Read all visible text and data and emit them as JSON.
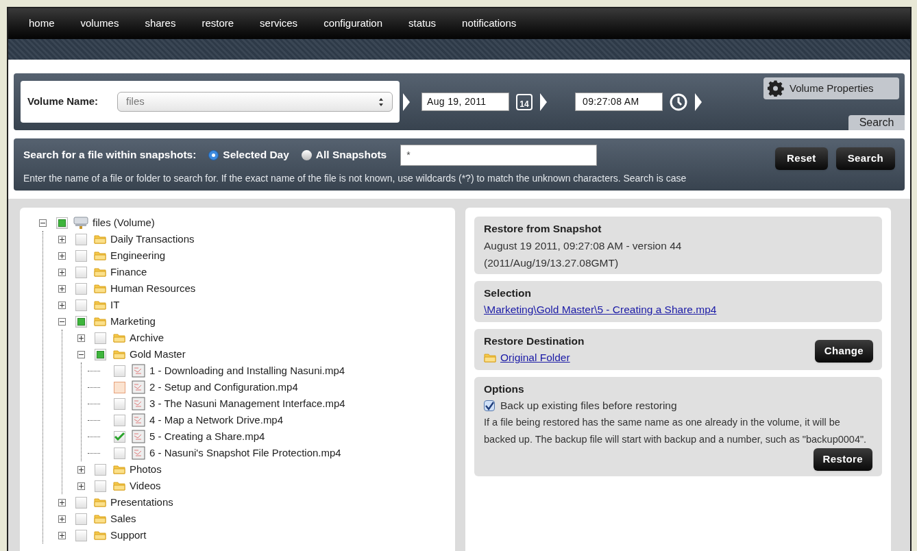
{
  "nav": [
    "home",
    "volumes",
    "shares",
    "restore",
    "services",
    "configuration",
    "status",
    "notifications"
  ],
  "snapshot_bar": {
    "volume_label": "Volume Name:",
    "volume_value": "files",
    "date": "Aug 19, 2011",
    "calendar_day": "14",
    "time": "09:27:08 AM",
    "properties_button": "Volume Properties",
    "tab": "Search"
  },
  "search": {
    "label": "Search for a file within snapshots:",
    "options": [
      {
        "label": "Selected Day",
        "selected": true
      },
      {
        "label": "All Snapshots",
        "selected": false
      }
    ],
    "value": "*",
    "buttons": [
      "Reset",
      "Search"
    ],
    "help": "Enter the name of a file or folder to search for. If the exact name of the file is not known, use wildcards (*?) to match the unknown characters. Search is case"
  },
  "tree": [
    {
      "label": "files (Volume)",
      "kind": "volume",
      "checked": false,
      "partial": true,
      "expanded": true,
      "children": [
        {
          "label": "Daily Transactions",
          "kind": "folder",
          "checked": false,
          "partial": false,
          "expanded": false
        },
        {
          "label": "Engineering",
          "kind": "folder",
          "checked": false,
          "partial": false,
          "expanded": false
        },
        {
          "label": "Finance",
          "kind": "folder",
          "checked": false,
          "partial": false,
          "expanded": false
        },
        {
          "label": "Human Resources",
          "kind": "folder",
          "checked": false,
          "partial": false,
          "expanded": false
        },
        {
          "label": "IT",
          "kind": "folder",
          "checked": false,
          "partial": false,
          "expanded": false
        },
        {
          "label": "Marketing",
          "kind": "folder",
          "checked": false,
          "partial": true,
          "expanded": true,
          "children": [
            {
              "label": "Archive",
              "kind": "folder",
              "checked": false,
              "partial": false,
              "expanded": false
            },
            {
              "label": "Gold Master",
              "kind": "folder",
              "checked": false,
              "partial": true,
              "expanded": true,
              "children": [
                {
                  "label": "1 - Downloading and Installing Nasuni.mp4",
                  "kind": "file",
                  "checked": false,
                  "partial": false,
                  "highlighted": false
                },
                {
                  "label": "2 - Setup and Configuration.mp4",
                  "kind": "file",
                  "checked": false,
                  "partial": false,
                  "highlighted": true
                },
                {
                  "label": "3 - The Nasuni Management Interface.mp4",
                  "kind": "file",
                  "checked": false,
                  "partial": false,
                  "highlighted": false
                },
                {
                  "label": "4 - Map a Network Drive.mp4",
                  "kind": "file",
                  "checked": false,
                  "partial": false,
                  "highlighted": false
                },
                {
                  "label": "5 - Creating a Share.mp4",
                  "kind": "file",
                  "checked": true,
                  "partial": false,
                  "highlighted": false
                },
                {
                  "label": "6 - Nasuni's Snapshot File Protection.mp4",
                  "kind": "file",
                  "checked": false,
                  "partial": false,
                  "highlighted": false
                }
              ]
            },
            {
              "label": "Photos",
              "kind": "folder",
              "checked": false,
              "partial": false,
              "expanded": false
            },
            {
              "label": "Videos",
              "kind": "folder",
              "checked": false,
              "partial": false,
              "expanded": false
            }
          ]
        },
        {
          "label": "Presentations",
          "kind": "folder",
          "checked": false,
          "partial": false,
          "expanded": false
        },
        {
          "label": "Sales",
          "kind": "folder",
          "checked": false,
          "partial": false,
          "expanded": false
        },
        {
          "label": "Support",
          "kind": "folder",
          "checked": false,
          "partial": false,
          "expanded": false
        }
      ]
    }
  ],
  "restore": {
    "snapshot": {
      "title": "Restore from Snapshot",
      "lines": [
        "August 19 2011, 09:27:08 AM - version 44",
        "(2011/Aug/19/13.27.08GMT)"
      ]
    },
    "selection": {
      "title": "Selection",
      "link": "\\Marketing\\Gold Master\\5 - Creating a Share.mp4"
    },
    "destination": {
      "title": "Restore Destination",
      "link": "Original Folder",
      "button": "Change"
    },
    "options": {
      "title": "Options",
      "backup_label": "Back up existing files before restoring",
      "backup_checked": true,
      "note": "If a file being restored has the same name as one already in the volume, it will be backed up. The backup file will start with backup and a number, such as \"backup0004\".",
      "button": "Restore"
    }
  }
}
